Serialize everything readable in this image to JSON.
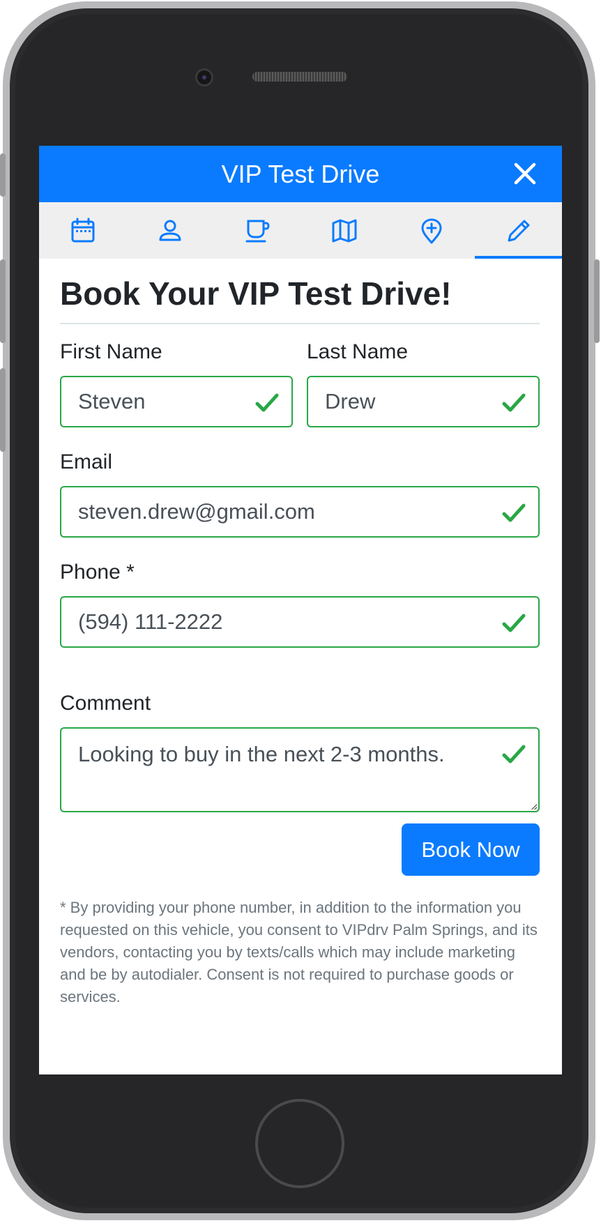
{
  "header": {
    "title": "VIP Test Drive"
  },
  "tabs": [
    {
      "icon": "calendar-icon"
    },
    {
      "icon": "person-icon"
    },
    {
      "icon": "coffee-cup-icon"
    },
    {
      "icon": "map-icon"
    },
    {
      "icon": "location-pin-plus-icon"
    },
    {
      "icon": "pencil-icon",
      "active": true
    }
  ],
  "form": {
    "heading": "Book Your VIP Test Drive!",
    "first_name": {
      "label": "First Name",
      "value": "Steven"
    },
    "last_name": {
      "label": "Last Name",
      "value": "Drew"
    },
    "email": {
      "label": "Email",
      "value": "steven.drew@gmail.com"
    },
    "phone": {
      "label": "Phone *",
      "value": "(594) 111-2222"
    },
    "comment": {
      "label": "Comment",
      "value": "Looking to buy in the next 2-3 months."
    },
    "submit_label": "Book Now",
    "disclaimer": "* By providing your phone number, in addition to the information you requested on this vehicle, you consent to VIPdrv Palm Springs, and its vendors, contacting you by texts/calls which may include marketing and be by autodialer. Consent is not required to purchase goods or services."
  },
  "colors": {
    "primary": "#0a7bff",
    "valid": "#28a745",
    "muted": "#6c757d"
  }
}
